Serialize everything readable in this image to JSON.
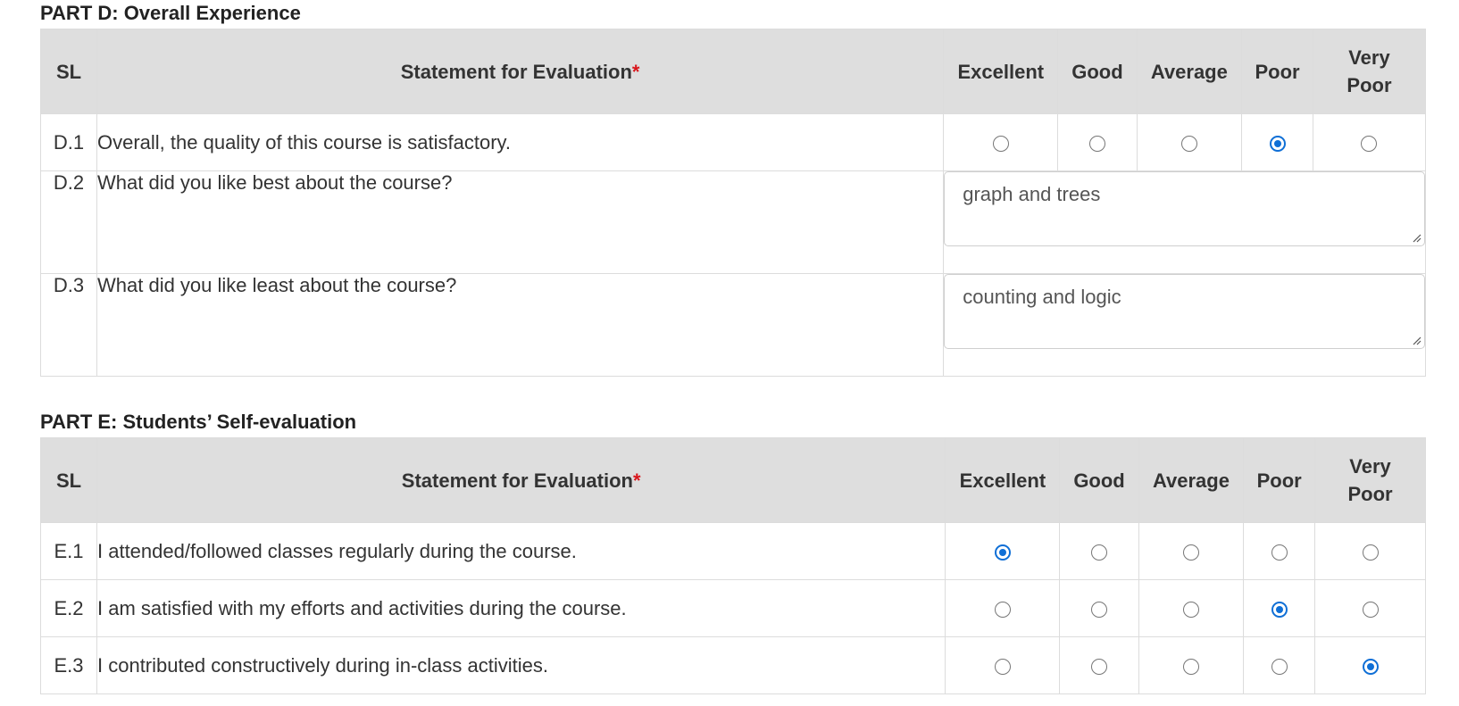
{
  "part_d": {
    "title": "PART D: Overall Experience",
    "headers": {
      "sl": "SL",
      "statement": "Statement for Evaluation",
      "required_mark": "*",
      "excellent": "Excellent",
      "good": "Good",
      "average": "Average",
      "poor": "Poor",
      "very": "Very",
      "poor2": "Poor"
    },
    "rows": [
      {
        "sl": "D.1",
        "statement": "Overall, the quality of this course is satisfactory.",
        "selected": "Poor"
      },
      {
        "sl": "D.2",
        "statement": "What did you like best about the course?",
        "answer": "graph and trees"
      },
      {
        "sl": "D.3",
        "statement": "What did you like least about the course?",
        "answer": "counting and logic"
      }
    ]
  },
  "part_e": {
    "title": "PART E: Students’ Self-evaluation",
    "headers": {
      "sl": "SL",
      "statement": "Statement for Evaluation",
      "required_mark": "*",
      "excellent": "Excellent",
      "good": "Good",
      "average": "Average",
      "poor": "Poor",
      "very": "Very",
      "poor2": "Poor"
    },
    "rows": [
      {
        "sl": "E.1",
        "statement": "I attended/followed classes regularly during the course.",
        "selected": "Excellent"
      },
      {
        "sl": "E.2",
        "statement": "I am satisfied with my efforts and activities during the course.",
        "selected": "Poor"
      },
      {
        "sl": "E.3",
        "statement": "I contributed constructively during in-class activities.",
        "selected": "Very Poor"
      }
    ]
  },
  "colors": {
    "radio_selected": "#0f6fd6",
    "header_bg": "#dedede",
    "required": "#d9161c"
  }
}
